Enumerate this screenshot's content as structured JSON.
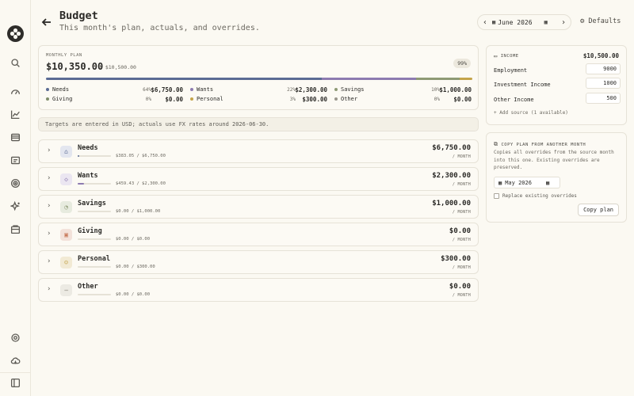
{
  "header": {
    "title": "Budget",
    "subtitle": "This month's plan, actuals, and overrides.",
    "month": "June 2026",
    "defaults_label": "Defaults"
  },
  "sidebar": {
    "items": [
      "logo",
      "search",
      "dashboard",
      "charts",
      "accounts",
      "transactions",
      "goals",
      "insights",
      "budget",
      "settings",
      "cloud",
      "collapse"
    ]
  },
  "plan": {
    "label": "MONTHLY PLAN",
    "amount": "$10,350.00",
    "of_income": "/ $10,500.00",
    "percent": "99%",
    "allocation": [
      {
        "name": "Needs",
        "share": 0.64,
        "color": "#5b6b94"
      },
      {
        "name": "Wants",
        "share": 0.22,
        "color": "#8d7bb0"
      },
      {
        "name": "Savings",
        "share": 0.1,
        "color": "#8e9a74"
      },
      {
        "name": "Giving",
        "share": 0.0,
        "color": "#c97b5c"
      },
      {
        "name": "Personal",
        "share": 0.03,
        "color": "#c4a44a"
      },
      {
        "name": "Other",
        "share": 0.0,
        "color": "#9a968c"
      }
    ],
    "summary": [
      {
        "name": "Needs",
        "pct": "64%",
        "value": "$6,750.00",
        "color": "#5b6b94"
      },
      {
        "name": "Wants",
        "pct": "22%",
        "value": "$2,300.00",
        "color": "#8d7bb0"
      },
      {
        "name": "Savings",
        "pct": "10%",
        "value": "$1,000.00",
        "color": "#8e9a74"
      },
      {
        "name": "Giving",
        "pct": "0%",
        "value": "$0.00",
        "color": "#7f8d6a"
      },
      {
        "name": "Personal",
        "pct": "3%",
        "value": "$300.00",
        "color": "#c4a44a"
      },
      {
        "name": "Other",
        "pct": "0%",
        "value": "$0.00",
        "color": "#9a968c"
      }
    ]
  },
  "note": "Targets are entered in USD; actuals use FX rates around 2026-06-30.",
  "categories": [
    {
      "name": "Needs",
      "progress": "$383.05 / $6,750.00",
      "spent": 0.057,
      "target": "$6,750.00",
      "per": "/ MONTH",
      "icon": "home",
      "icon_bg": "#e3e6ef",
      "fill": "#5b6b94"
    },
    {
      "name": "Wants",
      "progress": "$459.43 / $2,300.00",
      "spent": 0.2,
      "target": "$2,300.00",
      "per": "/ MONTH",
      "icon": "tag",
      "icon_bg": "#ebe6f1",
      "fill": "#8d7bb0"
    },
    {
      "name": "Savings",
      "progress": "$0.00 / $1,000.00",
      "spent": 0,
      "target": "$1,000.00",
      "per": "/ MONTH",
      "icon": "piggy",
      "icon_bg": "#e7ebdf",
      "fill": "#8e9a74"
    },
    {
      "name": "Giving",
      "progress": "$0.00 / $0.00",
      "spent": 0,
      "target": "$0.00",
      "per": "/ MONTH",
      "icon": "gift",
      "icon_bg": "#f3e2da",
      "fill": "#c97b5c"
    },
    {
      "name": "Personal",
      "progress": "$0.00 / $300.00",
      "spent": 0,
      "target": "$300.00",
      "per": "/ MONTH",
      "icon": "user",
      "icon_bg": "#f2ead4",
      "fill": "#c4a44a"
    },
    {
      "name": "Other",
      "progress": "$0.00 / $0.00",
      "spent": 0,
      "target": "$0.00",
      "per": "/ MONTH",
      "icon": "dots",
      "icon_bg": "#eceae3",
      "fill": "#9a968c"
    }
  ],
  "income": {
    "title": "INCOME",
    "total": "$10,500.00",
    "sources": [
      {
        "label": "Employment",
        "value": "9000"
      },
      {
        "label": "Investment Income",
        "value": "1000"
      },
      {
        "label": "Other Income",
        "value": "500"
      }
    ],
    "add_label": "+ Add source (1 available)"
  },
  "copy_plan": {
    "title": "COPY PLAN FROM ANOTHER MONTH",
    "description": "Copies all overrides from the source month into this one. Existing overrides are preserved.",
    "source_month": "May 2026",
    "replace_label": "Replace existing overrides",
    "button_label": "Copy plan"
  }
}
